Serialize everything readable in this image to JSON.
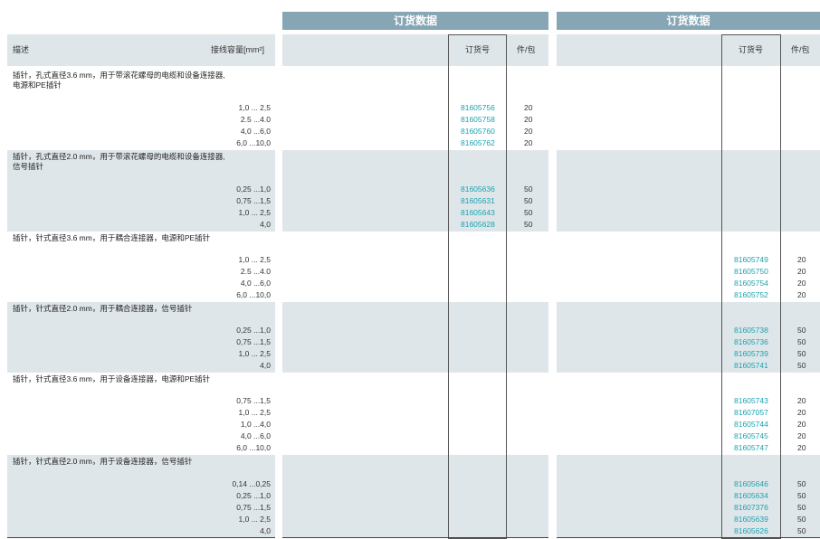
{
  "header": {
    "order_data_left": "订货数据",
    "order_data_right": "订货数据"
  },
  "columns": {
    "description": "描述",
    "wire_capacity": "接线容量[mm²]",
    "order_no_left": "订货号",
    "pack_left": "件/包",
    "order_no_right": "订货号",
    "pack_right": "件/包"
  },
  "groups": [
    {
      "title_line1": "插针，孔式直径3.6 mm，用于带滚花螺母的电缆和设备连接器,",
      "title_line2": "电源和PE插针",
      "rows": [
        {
          "range": "1,0 ... 2,5",
          "left_order": "81605756",
          "left_qty": "20"
        },
        {
          "range": "2.5 ...4.0",
          "left_order": "81605758",
          "left_qty": "20"
        },
        {
          "range": "4,0 ...6,0",
          "left_order": "81605760",
          "left_qty": "20"
        },
        {
          "range": "6,0 ...10,0",
          "left_order": "81605762",
          "left_qty": "20"
        }
      ]
    },
    {
      "title_line1": "插针，孔式直径2.0 mm，用于带滚花螺母的电缆和设备连接器,",
      "title_line2": "信号插针",
      "rows": [
        {
          "range": "0,25 ...1,0",
          "left_order": "81605636",
          "left_qty": "50"
        },
        {
          "range": "0,75 ...1,5",
          "left_order": "81605631",
          "left_qty": "50"
        },
        {
          "range": "1,0 ... 2,5",
          "left_order": "81605643",
          "left_qty": "50"
        },
        {
          "range": "4,0",
          "left_order": "81605628",
          "left_qty": "50"
        }
      ]
    },
    {
      "title_line1": "插针，针式直径3.6 mm，用于耦合连接器，电源和PE插针",
      "title_line2": "",
      "rows": [
        {
          "range": "1,0 ... 2,5",
          "right_order": "81605749",
          "right_qty": "20"
        },
        {
          "range": "2.5 ...4.0",
          "right_order": "81605750",
          "right_qty": "20"
        },
        {
          "range": "4,0 ...6,0",
          "right_order": "81605754",
          "right_qty": "20"
        },
        {
          "range": "6,0 ...10,0",
          "right_order": "81605752",
          "right_qty": "20"
        }
      ]
    },
    {
      "title_line1": "插针，针式直径2.0 mm，用于耦合连接器，信号插针",
      "title_line2": "",
      "rows": [
        {
          "range": "0,25 ...1,0",
          "right_order": "81605738",
          "right_qty": "50"
        },
        {
          "range": "0,75 ...1,5",
          "right_order": "81605736",
          "right_qty": "50"
        },
        {
          "range": "1,0 ... 2,5",
          "right_order": "81605739",
          "right_qty": "50"
        },
        {
          "range": "4,0",
          "right_order": "81605741",
          "right_qty": "50"
        }
      ]
    },
    {
      "title_line1": "插针，针式直径3.6 mm，用于设备连接器，电源和PE插针",
      "title_line2": "",
      "rows": [
        {
          "range": "0,75 ...1,5",
          "right_order": "81605743",
          "right_qty": "20"
        },
        {
          "range": "1,0 ... 2,5",
          "right_order": "81607057",
          "right_qty": "20"
        },
        {
          "range": "1,0 ...4,0",
          "right_order": "81605744",
          "right_qty": "20"
        },
        {
          "range": "4,0 ...6,0",
          "right_order": "81605745",
          "right_qty": "20"
        },
        {
          "range": "6,0 ...10,0",
          "right_order": "81605747",
          "right_qty": "20"
        }
      ]
    },
    {
      "title_line1": "插针，针式直径2.0 mm，用于设备连接器，信号插针",
      "title_line2": "",
      "rows": [
        {
          "range": "0,14 ...0,25",
          "right_order": "81605646",
          "right_qty": "50"
        },
        {
          "range": "0,25 ...1,0",
          "right_order": "81605634",
          "right_qty": "50"
        },
        {
          "range": "0,75 ...1,5",
          "right_order": "81607376",
          "right_qty": "50"
        },
        {
          "range": "1,0 ... 2,5",
          "right_order": "81605639",
          "right_qty": "50"
        },
        {
          "range": "4,0",
          "right_order": "81605626",
          "right_qty": "50"
        }
      ]
    }
  ]
}
